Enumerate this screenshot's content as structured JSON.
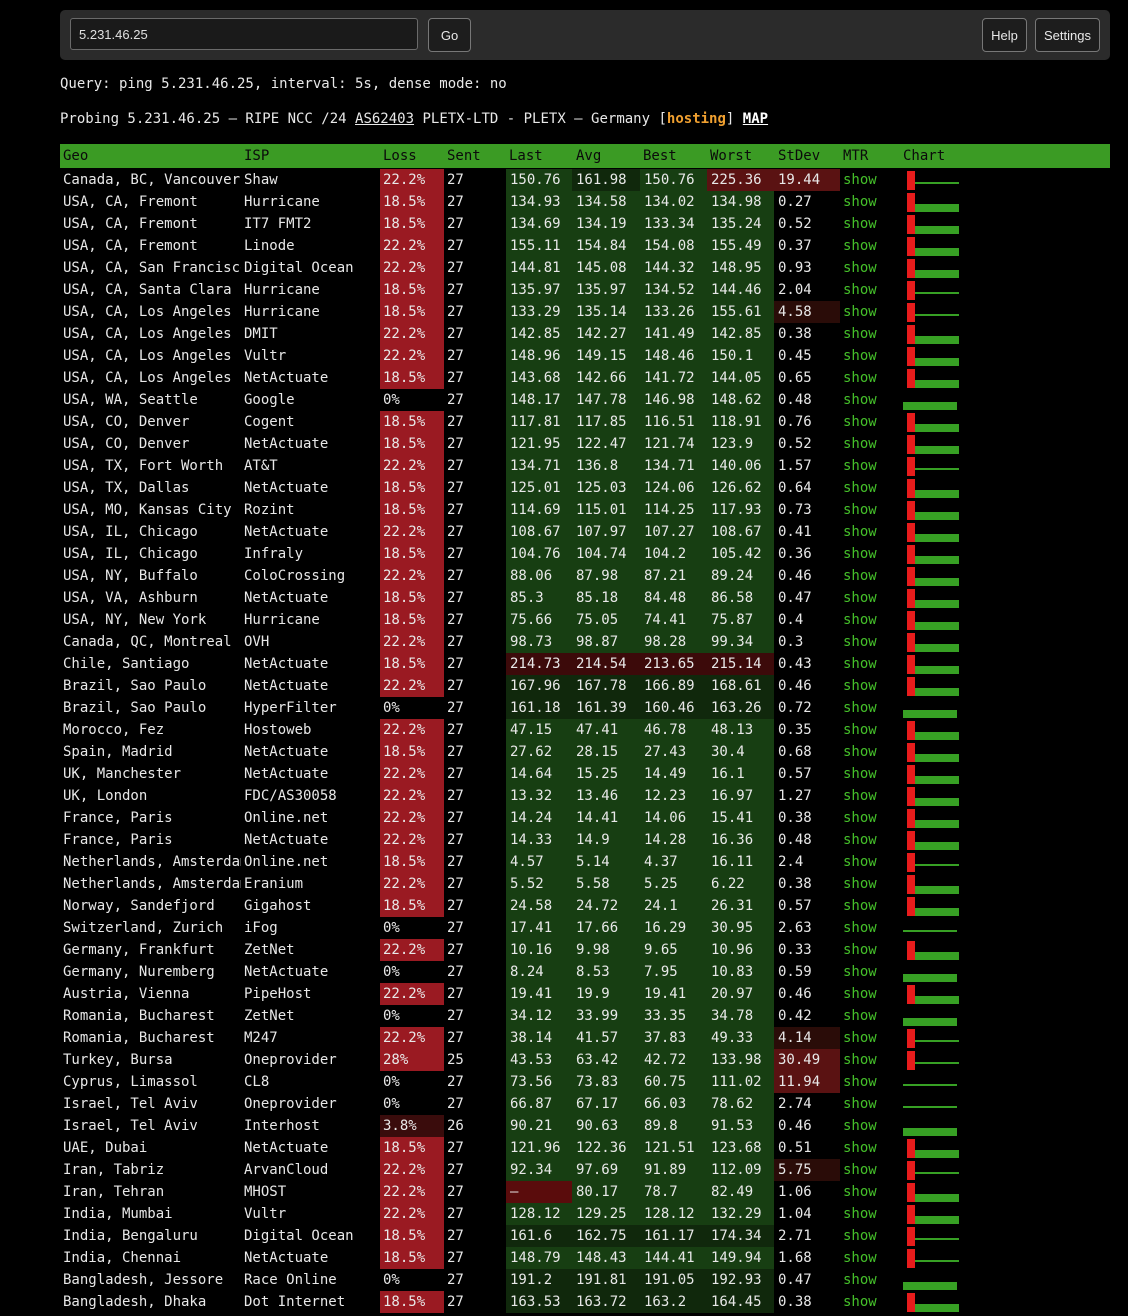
{
  "toolbar": {
    "query_value": "5.231.46.25",
    "go_label": "Go",
    "help_label": "Help",
    "settings_label": "Settings"
  },
  "info": {
    "query_line": "Query: ping 5.231.46.25, interval: 5s, dense mode: no",
    "probe_prefix": "Probing 5.231.46.25 — RIPE NCC /24 ",
    "asn": "AS62403",
    "probe_mid": " PLETX-LTD - PLETX — Germany [",
    "tag": "hosting",
    "probe_close": "] ",
    "map_label": "MAP"
  },
  "columns": [
    "Geo",
    "ISP",
    "Loss",
    "Sent",
    "Last",
    "Avg",
    "Best",
    "Worst",
    "StDev",
    "MTR",
    "Chart"
  ],
  "mtr_label": "show",
  "colors": {
    "header": "#3b9b24",
    "link": "#45c02a",
    "loss_high": "#9a1a22",
    "loss_mid": "#6e1018",
    "lat_green": "#173e12",
    "lat_green_dark": "#10280c",
    "lat_red": "#3c0a0a",
    "chart_bar": "#37a024",
    "chart_loss": "#e81c1c"
  },
  "rows": [
    [
      "Canada, BC, Vancouver",
      "Shaw",
      "22.2%",
      "27",
      "150.76",
      "161.98",
      "150.76",
      "225.36",
      "19.44"
    ],
    [
      "USA, CA, Fremont",
      "Hurricane",
      "18.5%",
      "27",
      "134.93",
      "134.58",
      "134.02",
      "134.98",
      "0.27"
    ],
    [
      "USA, CA, Fremont",
      "IT7 FMT2",
      "18.5%",
      "27",
      "134.69",
      "134.19",
      "133.34",
      "135.24",
      "0.52"
    ],
    [
      "USA, CA, Fremont",
      "Linode",
      "22.2%",
      "27",
      "155.11",
      "154.84",
      "154.08",
      "155.49",
      "0.37"
    ],
    [
      "USA, CA, San Francisco",
      "Digital Ocean",
      "22.2%",
      "27",
      "144.81",
      "145.08",
      "144.32",
      "148.95",
      "0.93"
    ],
    [
      "USA, CA, Santa Clara",
      "Hurricane",
      "18.5%",
      "27",
      "135.97",
      "135.97",
      "134.52",
      "144.46",
      "2.04"
    ],
    [
      "USA, CA, Los Angeles",
      "Hurricane",
      "18.5%",
      "27",
      "133.29",
      "135.14",
      "133.26",
      "155.61",
      "4.58"
    ],
    [
      "USA, CA, Los Angeles",
      "DMIT",
      "22.2%",
      "27",
      "142.85",
      "142.27",
      "141.49",
      "142.85",
      "0.38"
    ],
    [
      "USA, CA, Los Angeles",
      "Vultr",
      "22.2%",
      "27",
      "148.96",
      "149.15",
      "148.46",
      "150.1",
      "0.45"
    ],
    [
      "USA, CA, Los Angeles",
      "NetActuate",
      "18.5%",
      "27",
      "143.68",
      "142.66",
      "141.72",
      "144.05",
      "0.65"
    ],
    [
      "USA, WA, Seattle",
      "Google",
      "0%",
      "27",
      "148.17",
      "147.78",
      "146.98",
      "148.62",
      "0.48"
    ],
    [
      "USA, CO, Denver",
      "Cogent",
      "18.5%",
      "27",
      "117.81",
      "117.85",
      "116.51",
      "118.91",
      "0.76"
    ],
    [
      "USA, CO, Denver",
      "NetActuate",
      "18.5%",
      "27",
      "121.95",
      "122.47",
      "121.74",
      "123.9",
      "0.52"
    ],
    [
      "USA, TX, Fort Worth",
      "AT&T",
      "22.2%",
      "27",
      "134.71",
      "136.8",
      "134.71",
      "140.06",
      "1.57"
    ],
    [
      "USA, TX, Dallas",
      "NetActuate",
      "18.5%",
      "27",
      "125.01",
      "125.03",
      "124.06",
      "126.62",
      "0.64"
    ],
    [
      "USA, MO, Kansas City",
      "Rozint",
      "18.5%",
      "27",
      "114.69",
      "115.01",
      "114.25",
      "117.93",
      "0.73"
    ],
    [
      "USA, IL, Chicago",
      "NetActuate",
      "22.2%",
      "27",
      "108.67",
      "107.97",
      "107.27",
      "108.67",
      "0.41"
    ],
    [
      "USA, IL, Chicago",
      "Infraly",
      "18.5%",
      "27",
      "104.76",
      "104.74",
      "104.2",
      "105.42",
      "0.36"
    ],
    [
      "USA, NY, Buffalo",
      "ColoCrossing",
      "22.2%",
      "27",
      "88.06",
      "87.98",
      "87.21",
      "89.24",
      "0.46"
    ],
    [
      "USA, VA, Ashburn",
      "NetActuate",
      "18.5%",
      "27",
      "85.3",
      "85.18",
      "84.48",
      "86.58",
      "0.47"
    ],
    [
      "USA, NY, New York",
      "Hurricane",
      "18.5%",
      "27",
      "75.66",
      "75.05",
      "74.41",
      "75.87",
      "0.4"
    ],
    [
      "Canada, QC, Montreal",
      "OVH",
      "22.2%",
      "27",
      "98.73",
      "98.87",
      "98.28",
      "99.34",
      "0.3"
    ],
    [
      "Chile, Santiago",
      "NetActuate",
      "18.5%",
      "27",
      "214.73",
      "214.54",
      "213.65",
      "215.14",
      "0.43"
    ],
    [
      "Brazil, Sao Paulo",
      "NetActuate",
      "22.2%",
      "27",
      "167.96",
      "167.78",
      "166.89",
      "168.61",
      "0.46"
    ],
    [
      "Brazil, Sao Paulo",
      "HyperFilter",
      "0%",
      "27",
      "161.18",
      "161.39",
      "160.46",
      "163.26",
      "0.72"
    ],
    [
      "Morocco, Fez",
      "Hostoweb",
      "22.2%",
      "27",
      "47.15",
      "47.41",
      "46.78",
      "48.13",
      "0.35"
    ],
    [
      "Spain, Madrid",
      "NetActuate",
      "18.5%",
      "27",
      "27.62",
      "28.15",
      "27.43",
      "30.4",
      "0.68"
    ],
    [
      "UK, Manchester",
      "NetActuate",
      "22.2%",
      "27",
      "14.64",
      "15.25",
      "14.49",
      "16.1",
      "0.57"
    ],
    [
      "UK, London",
      "FDC/AS30058",
      "22.2%",
      "27",
      "13.32",
      "13.46",
      "12.23",
      "16.97",
      "1.27"
    ],
    [
      "France, Paris",
      "Online.net",
      "22.2%",
      "27",
      "14.24",
      "14.41",
      "14.06",
      "15.41",
      "0.38"
    ],
    [
      "France, Paris",
      "NetActuate",
      "22.2%",
      "27",
      "14.33",
      "14.9",
      "14.28",
      "16.36",
      "0.48"
    ],
    [
      "Netherlands, Amsterdam",
      "Online.net",
      "18.5%",
      "27",
      "4.57",
      "5.14",
      "4.37",
      "16.11",
      "2.4"
    ],
    [
      "Netherlands, Amsterdam",
      "Eranium",
      "22.2%",
      "27",
      "5.52",
      "5.58",
      "5.25",
      "6.22",
      "0.38"
    ],
    [
      "Norway, Sandefjord",
      "Gigahost",
      "18.5%",
      "27",
      "24.58",
      "24.72",
      "24.1",
      "26.31",
      "0.57"
    ],
    [
      "Switzerland, Zurich",
      "iFog",
      "0%",
      "27",
      "17.41",
      "17.66",
      "16.29",
      "30.95",
      "2.63"
    ],
    [
      "Germany, Frankfurt",
      "ZetNet",
      "22.2%",
      "27",
      "10.16",
      "9.98",
      "9.65",
      "10.96",
      "0.33"
    ],
    [
      "Germany, Nuremberg",
      "NetActuate",
      "0%",
      "27",
      "8.24",
      "8.53",
      "7.95",
      "10.83",
      "0.59"
    ],
    [
      "Austria, Vienna",
      "PipeHost",
      "22.2%",
      "27",
      "19.41",
      "19.9",
      "19.41",
      "20.97",
      "0.46"
    ],
    [
      "Romania, Bucharest",
      "ZetNet",
      "0%",
      "27",
      "34.12",
      "33.99",
      "33.35",
      "34.78",
      "0.42"
    ],
    [
      "Romania, Bucharest",
      "M247",
      "22.2%",
      "27",
      "38.14",
      "41.57",
      "37.83",
      "49.33",
      "4.14"
    ],
    [
      "Turkey, Bursa",
      "Oneprovider",
      "28%",
      "25",
      "43.53",
      "63.42",
      "42.72",
      "133.98",
      "30.49"
    ],
    [
      "Cyprus, Limassol",
      "CL8",
      "0%",
      "27",
      "73.56",
      "73.83",
      "60.75",
      "111.02",
      "11.94"
    ],
    [
      "Israel, Tel Aviv",
      "Oneprovider",
      "0%",
      "27",
      "66.87",
      "67.17",
      "66.03",
      "78.62",
      "2.74"
    ],
    [
      "Israel, Tel Aviv",
      "Interhost",
      "3.8%",
      "26",
      "90.21",
      "90.63",
      "89.8",
      "91.53",
      "0.46"
    ],
    [
      "UAE, Dubai",
      "NetActuate",
      "18.5%",
      "27",
      "121.96",
      "122.36",
      "121.51",
      "123.68",
      "0.51"
    ],
    [
      "Iran, Tabriz",
      "ArvanCloud",
      "22.2%",
      "27",
      "92.34",
      "97.69",
      "91.89",
      "112.09",
      "5.75"
    ],
    [
      "Iran, Tehran",
      "MHOST",
      "22.2%",
      "27",
      "–",
      "80.17",
      "78.7",
      "82.49",
      "1.06"
    ],
    [
      "India, Mumbai",
      "Vultr",
      "22.2%",
      "27",
      "128.12",
      "129.25",
      "128.12",
      "132.29",
      "1.04"
    ],
    [
      "India, Bengaluru",
      "Digital Ocean",
      "18.5%",
      "27",
      "161.6",
      "162.75",
      "161.17",
      "174.34",
      "2.71"
    ],
    [
      "India, Chennai",
      "NetActuate",
      "18.5%",
      "27",
      "148.79",
      "148.43",
      "144.41",
      "149.94",
      "1.68"
    ],
    [
      "Bangladesh, Jessore",
      "Race Online",
      "0%",
      "27",
      "191.2",
      "191.81",
      "191.05",
      "192.93",
      "0.47"
    ],
    [
      "Bangladesh, Dhaka",
      "Dot Internet",
      "18.5%",
      "27",
      "163.53",
      "163.72",
      "163.2",
      "164.45",
      "0.38"
    ]
  ]
}
